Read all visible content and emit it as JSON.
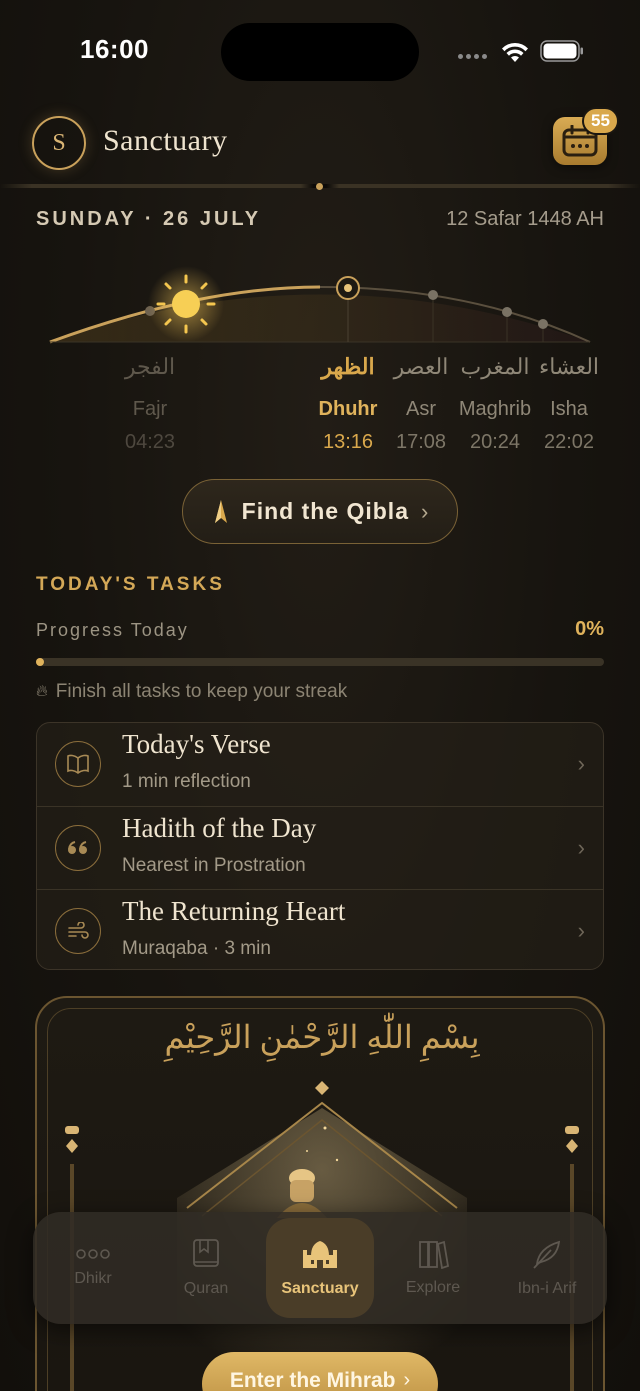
{
  "status_bar": {
    "time": "16:00"
  },
  "header": {
    "logo_letter": "S",
    "title": "Sanctuary",
    "calendar_badge": "55"
  },
  "date": {
    "gregorian": "SUNDAY · 26 JULY",
    "hijri": "12 Safar 1448 AH"
  },
  "prayers": [
    {
      "arabic": "الفجر",
      "name": "Fajr",
      "time": "04:23",
      "state": "past"
    },
    {
      "arabic": "الظهر",
      "name": "Dhuhr",
      "time": "13:16",
      "state": "active"
    },
    {
      "arabic": "العصر",
      "name": "Asr",
      "time": "17:08",
      "state": "future"
    },
    {
      "arabic": "المغرب",
      "name": "Maghrib",
      "time": "20:24",
      "state": "future"
    },
    {
      "arabic": "العشاء",
      "name": "Isha",
      "time": "22:02",
      "state": "future"
    }
  ],
  "qibla": {
    "label": "Find the Qibla"
  },
  "tasks": {
    "section_title": "TODAY'S TASKS",
    "progress_label": "Progress Today",
    "progress_value": "0%",
    "progress_fraction": 0,
    "streak_note": "Finish all tasks to keep your streak",
    "items": [
      {
        "title": "Today's Verse",
        "subtitle": "1 min reflection",
        "icon": "book-icon"
      },
      {
        "title": "Hadith of the Day",
        "subtitle": "Nearest in Prostration",
        "icon": "quote-icon"
      },
      {
        "title": "The Returning Heart",
        "subtitle": "Muraqaba · 3 min",
        "icon": "wind-icon"
      }
    ]
  },
  "mihrab": {
    "bismillah": "بِسْمِ اللّٰهِ الرَّحْمٰنِ الرَّحِيْمِ",
    "enter_label": "Enter the Mihrab"
  },
  "nav": {
    "items": [
      {
        "label": "Dhikr",
        "icon": "dots-icon"
      },
      {
        "label": "Quran",
        "icon": "book-icon"
      },
      {
        "label": "Sanctuary",
        "icon": "mosque-icon",
        "active": true
      },
      {
        "label": "Explore",
        "icon": "books-icon"
      },
      {
        "label": "Ibn-i Arif",
        "icon": "feather-icon"
      }
    ]
  },
  "colors": {
    "accent": "#d9a84c",
    "background": "#17140f"
  }
}
